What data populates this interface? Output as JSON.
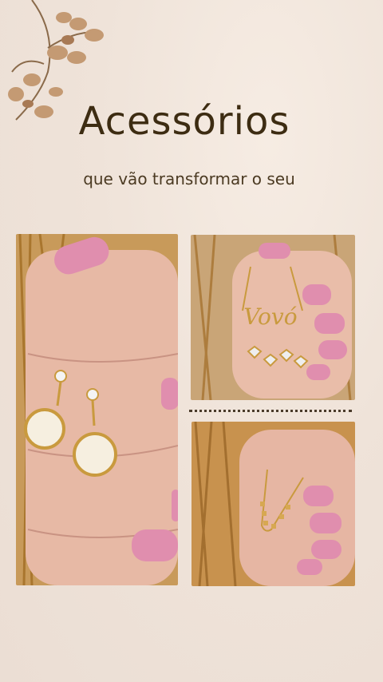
{
  "post": {
    "title": "Acessórios",
    "subtitle": "que vão transformar o seu"
  },
  "photos": [
    {
      "subject": "pearl-earrings",
      "engraving": ""
    },
    {
      "subject": "name-necklace",
      "engraving": "Vovó"
    },
    {
      "subject": "cube-chain-necklace",
      "engraving": ""
    }
  ],
  "colors": {
    "background": "#eee1d7",
    "title": "#3d2c12",
    "nail_pink": "#d98aa8",
    "gold": "#c99a3e"
  }
}
